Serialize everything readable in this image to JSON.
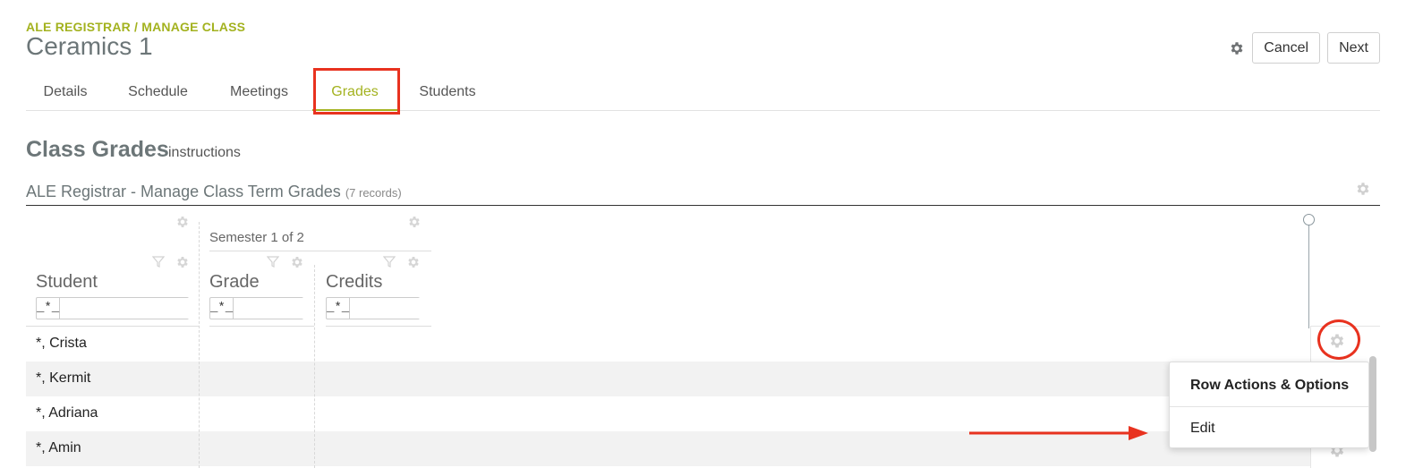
{
  "header": {
    "breadcrumb": "ALE REGISTRAR / MANAGE CLASS",
    "title": "Ceramics 1",
    "cancel_label": "Cancel",
    "next_label": "Next"
  },
  "tabs": [
    {
      "label": "Details"
    },
    {
      "label": "Schedule"
    },
    {
      "label": "Meetings"
    },
    {
      "label": "Grades",
      "active": true
    },
    {
      "label": "Students"
    }
  ],
  "section": {
    "title": "Class Grades",
    "instructions": "instructions"
  },
  "grid": {
    "title": "ALE Registrar - Manage Class Term Grades",
    "record_count": "(7 records)",
    "group_header": "Semester 1 of 2",
    "columns": [
      {
        "label": "Student",
        "filter_op": "_*_"
      },
      {
        "label": "Grade",
        "filter_op": "_*_"
      },
      {
        "label": "Credits",
        "filter_op": "_*_"
      }
    ],
    "rows": [
      {
        "student": "*, Crista"
      },
      {
        "student": "*, Kermit"
      },
      {
        "student": "*, Adriana"
      },
      {
        "student": "*, Amin"
      }
    ]
  },
  "row_menu": {
    "title": "Row Actions & Options",
    "items": [
      {
        "label": "Edit"
      }
    ]
  },
  "colors": {
    "accent": "#a3b21f",
    "highlight": "#e8321f",
    "title_gray": "#6c7678"
  },
  "icons": [
    "gear-icon",
    "filter-icon",
    "slider-knob-icon",
    "arrow-right-icon"
  ]
}
